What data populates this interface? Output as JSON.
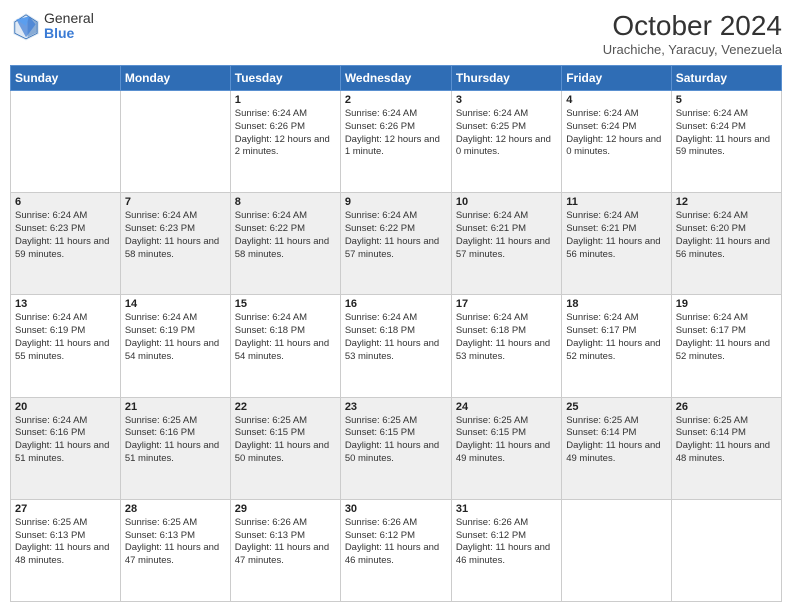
{
  "header": {
    "logo_general": "General",
    "logo_blue": "Blue",
    "title": "October 2024",
    "location": "Urachiche, Yaracuy, Venezuela"
  },
  "days_of_week": [
    "Sunday",
    "Monday",
    "Tuesday",
    "Wednesday",
    "Thursday",
    "Friday",
    "Saturday"
  ],
  "weeks": [
    [
      {
        "day": "",
        "sunrise": "",
        "sunset": "",
        "daylight": ""
      },
      {
        "day": "",
        "sunrise": "",
        "sunset": "",
        "daylight": ""
      },
      {
        "day": "1",
        "sunrise": "Sunrise: 6:24 AM",
        "sunset": "Sunset: 6:26 PM",
        "daylight": "Daylight: 12 hours and 2 minutes."
      },
      {
        "day": "2",
        "sunrise": "Sunrise: 6:24 AM",
        "sunset": "Sunset: 6:26 PM",
        "daylight": "Daylight: 12 hours and 1 minute."
      },
      {
        "day": "3",
        "sunrise": "Sunrise: 6:24 AM",
        "sunset": "Sunset: 6:25 PM",
        "daylight": "Daylight: 12 hours and 0 minutes."
      },
      {
        "day": "4",
        "sunrise": "Sunrise: 6:24 AM",
        "sunset": "Sunset: 6:24 PM",
        "daylight": "Daylight: 12 hours and 0 minutes."
      },
      {
        "day": "5",
        "sunrise": "Sunrise: 6:24 AM",
        "sunset": "Sunset: 6:24 PM",
        "daylight": "Daylight: 11 hours and 59 minutes."
      }
    ],
    [
      {
        "day": "6",
        "sunrise": "Sunrise: 6:24 AM",
        "sunset": "Sunset: 6:23 PM",
        "daylight": "Daylight: 11 hours and 59 minutes."
      },
      {
        "day": "7",
        "sunrise": "Sunrise: 6:24 AM",
        "sunset": "Sunset: 6:23 PM",
        "daylight": "Daylight: 11 hours and 58 minutes."
      },
      {
        "day": "8",
        "sunrise": "Sunrise: 6:24 AM",
        "sunset": "Sunset: 6:22 PM",
        "daylight": "Daylight: 11 hours and 58 minutes."
      },
      {
        "day": "9",
        "sunrise": "Sunrise: 6:24 AM",
        "sunset": "Sunset: 6:22 PM",
        "daylight": "Daylight: 11 hours and 57 minutes."
      },
      {
        "day": "10",
        "sunrise": "Sunrise: 6:24 AM",
        "sunset": "Sunset: 6:21 PM",
        "daylight": "Daylight: 11 hours and 57 minutes."
      },
      {
        "day": "11",
        "sunrise": "Sunrise: 6:24 AM",
        "sunset": "Sunset: 6:21 PM",
        "daylight": "Daylight: 11 hours and 56 minutes."
      },
      {
        "day": "12",
        "sunrise": "Sunrise: 6:24 AM",
        "sunset": "Sunset: 6:20 PM",
        "daylight": "Daylight: 11 hours and 56 minutes."
      }
    ],
    [
      {
        "day": "13",
        "sunrise": "Sunrise: 6:24 AM",
        "sunset": "Sunset: 6:19 PM",
        "daylight": "Daylight: 11 hours and 55 minutes."
      },
      {
        "day": "14",
        "sunrise": "Sunrise: 6:24 AM",
        "sunset": "Sunset: 6:19 PM",
        "daylight": "Daylight: 11 hours and 54 minutes."
      },
      {
        "day": "15",
        "sunrise": "Sunrise: 6:24 AM",
        "sunset": "Sunset: 6:18 PM",
        "daylight": "Daylight: 11 hours and 54 minutes."
      },
      {
        "day": "16",
        "sunrise": "Sunrise: 6:24 AM",
        "sunset": "Sunset: 6:18 PM",
        "daylight": "Daylight: 11 hours and 53 minutes."
      },
      {
        "day": "17",
        "sunrise": "Sunrise: 6:24 AM",
        "sunset": "Sunset: 6:18 PM",
        "daylight": "Daylight: 11 hours and 53 minutes."
      },
      {
        "day": "18",
        "sunrise": "Sunrise: 6:24 AM",
        "sunset": "Sunset: 6:17 PM",
        "daylight": "Daylight: 11 hours and 52 minutes."
      },
      {
        "day": "19",
        "sunrise": "Sunrise: 6:24 AM",
        "sunset": "Sunset: 6:17 PM",
        "daylight": "Daylight: 11 hours and 52 minutes."
      }
    ],
    [
      {
        "day": "20",
        "sunrise": "Sunrise: 6:24 AM",
        "sunset": "Sunset: 6:16 PM",
        "daylight": "Daylight: 11 hours and 51 minutes."
      },
      {
        "day": "21",
        "sunrise": "Sunrise: 6:25 AM",
        "sunset": "Sunset: 6:16 PM",
        "daylight": "Daylight: 11 hours and 51 minutes."
      },
      {
        "day": "22",
        "sunrise": "Sunrise: 6:25 AM",
        "sunset": "Sunset: 6:15 PM",
        "daylight": "Daylight: 11 hours and 50 minutes."
      },
      {
        "day": "23",
        "sunrise": "Sunrise: 6:25 AM",
        "sunset": "Sunset: 6:15 PM",
        "daylight": "Daylight: 11 hours and 50 minutes."
      },
      {
        "day": "24",
        "sunrise": "Sunrise: 6:25 AM",
        "sunset": "Sunset: 6:15 PM",
        "daylight": "Daylight: 11 hours and 49 minutes."
      },
      {
        "day": "25",
        "sunrise": "Sunrise: 6:25 AM",
        "sunset": "Sunset: 6:14 PM",
        "daylight": "Daylight: 11 hours and 49 minutes."
      },
      {
        "day": "26",
        "sunrise": "Sunrise: 6:25 AM",
        "sunset": "Sunset: 6:14 PM",
        "daylight": "Daylight: 11 hours and 48 minutes."
      }
    ],
    [
      {
        "day": "27",
        "sunrise": "Sunrise: 6:25 AM",
        "sunset": "Sunset: 6:13 PM",
        "daylight": "Daylight: 11 hours and 48 minutes."
      },
      {
        "day": "28",
        "sunrise": "Sunrise: 6:25 AM",
        "sunset": "Sunset: 6:13 PM",
        "daylight": "Daylight: 11 hours and 47 minutes."
      },
      {
        "day": "29",
        "sunrise": "Sunrise: 6:26 AM",
        "sunset": "Sunset: 6:13 PM",
        "daylight": "Daylight: 11 hours and 47 minutes."
      },
      {
        "day": "30",
        "sunrise": "Sunrise: 6:26 AM",
        "sunset": "Sunset: 6:12 PM",
        "daylight": "Daylight: 11 hours and 46 minutes."
      },
      {
        "day": "31",
        "sunrise": "Sunrise: 6:26 AM",
        "sunset": "Sunset: 6:12 PM",
        "daylight": "Daylight: 11 hours and 46 minutes."
      },
      {
        "day": "",
        "sunrise": "",
        "sunset": "",
        "daylight": ""
      },
      {
        "day": "",
        "sunrise": "",
        "sunset": "",
        "daylight": ""
      }
    ]
  ]
}
